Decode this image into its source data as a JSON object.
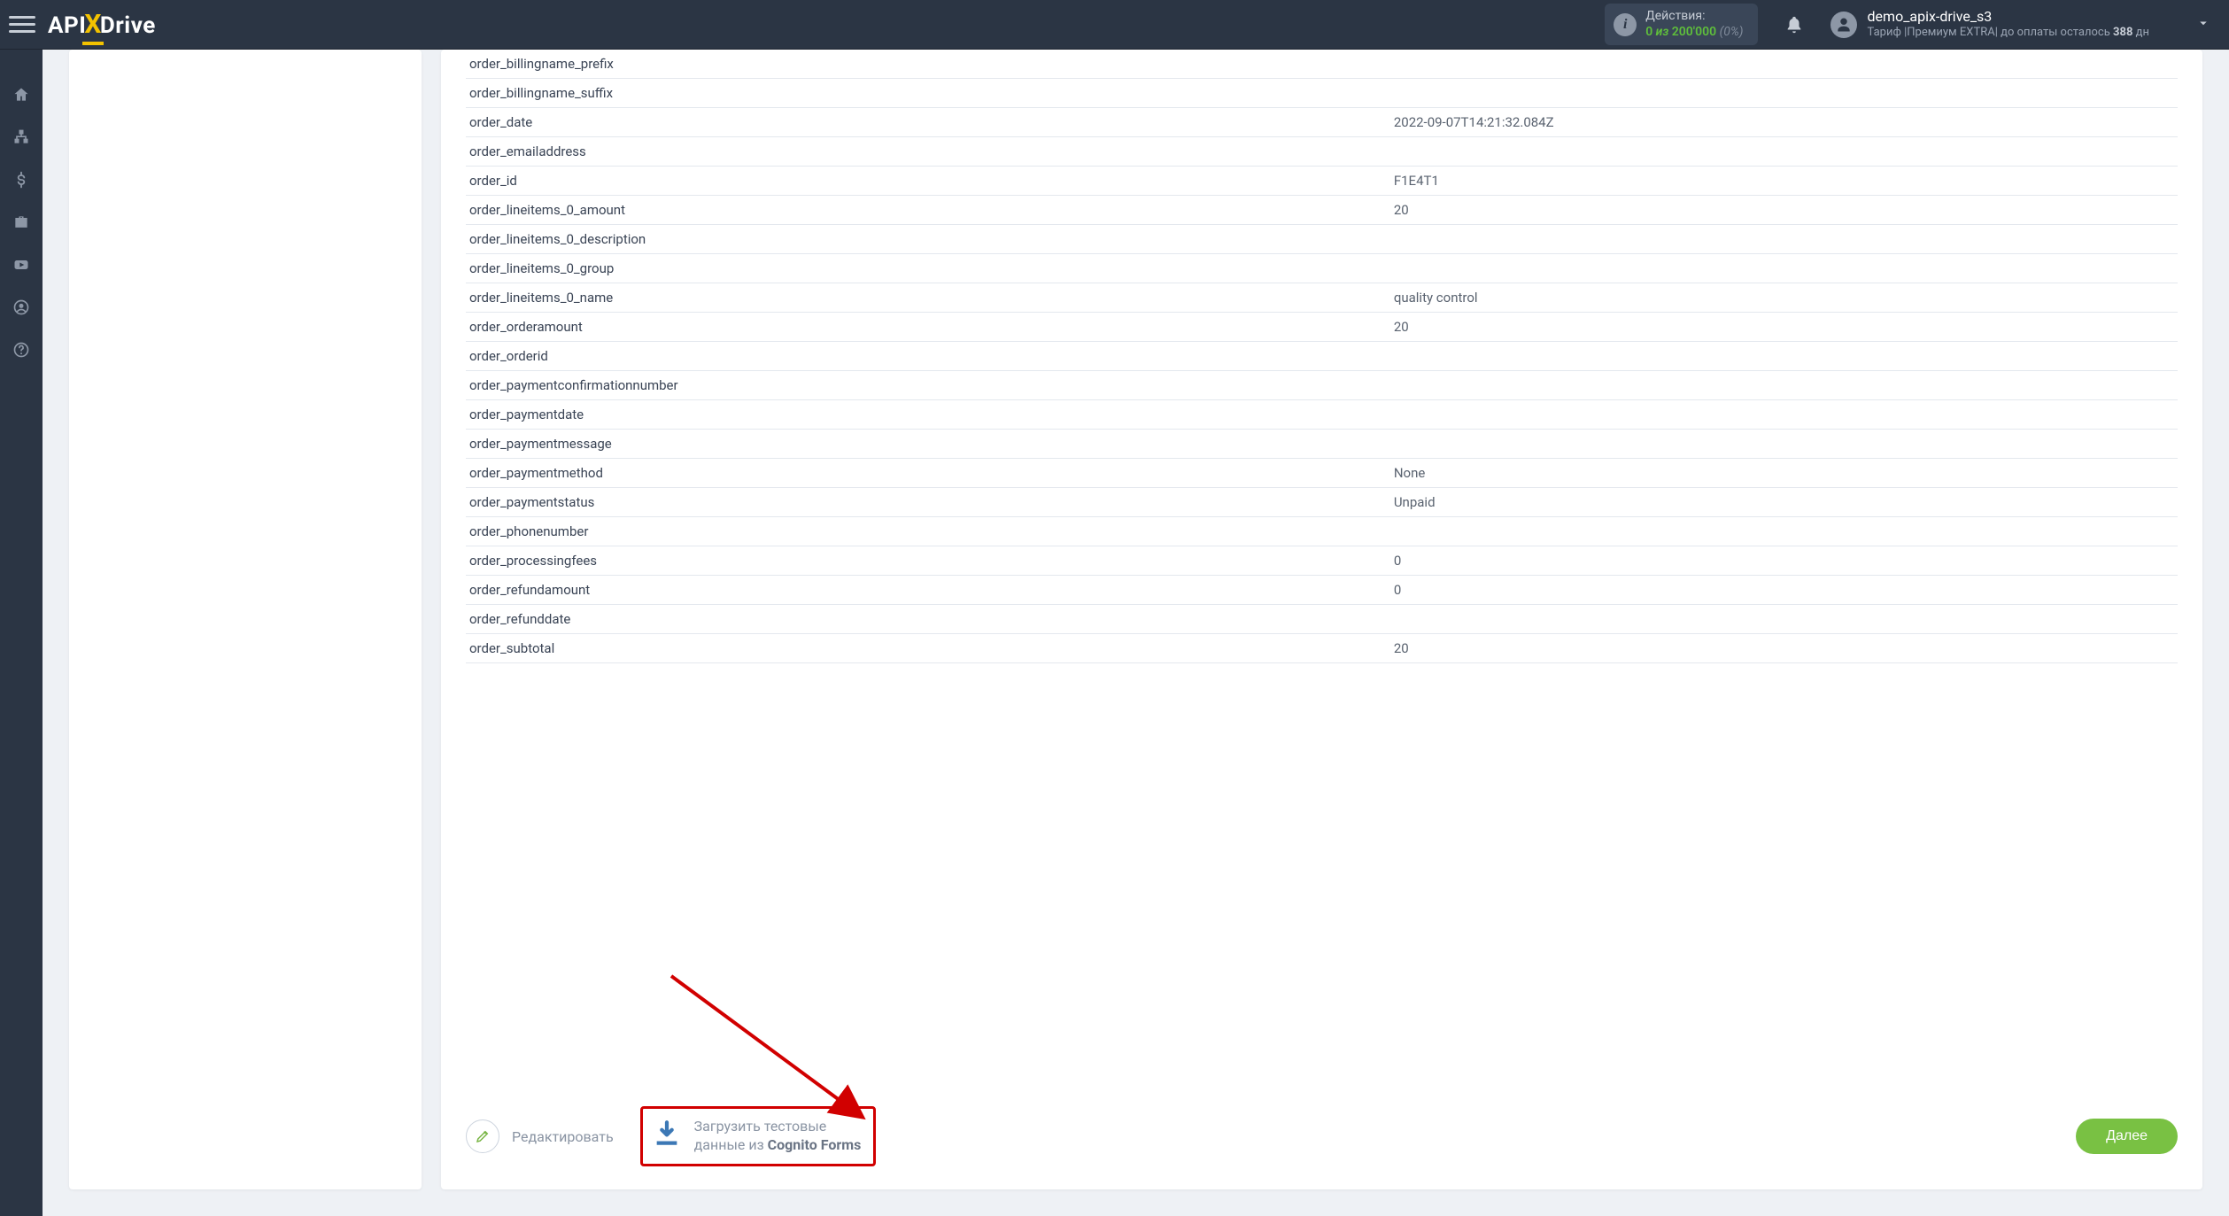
{
  "header": {
    "logo": {
      "part1": "API",
      "partX": "X",
      "part2": "Drive"
    },
    "actions": {
      "label": "Действия:",
      "used": "0",
      "sep": " из ",
      "total": "200'000",
      "pct": "(0%)"
    },
    "user": {
      "name": "demo_apix-drive_s3",
      "plan_prefix": "Тариф |",
      "plan_name": "Премиум EXTRA",
      "plan_mid": "| до оплаты осталось ",
      "days": "388",
      "days_unit": " дн"
    }
  },
  "rows": [
    {
      "key": "order_billingname_prefix",
      "val": ""
    },
    {
      "key": "order_billingname_suffix",
      "val": ""
    },
    {
      "key": "order_date",
      "val": "2022-09-07T14:21:32.084Z"
    },
    {
      "key": "order_emailaddress",
      "val": ""
    },
    {
      "key": "order_id",
      "val": "F1E4T1"
    },
    {
      "key": "order_lineitems_0_amount",
      "val": "20"
    },
    {
      "key": "order_lineitems_0_description",
      "val": ""
    },
    {
      "key": "order_lineitems_0_group",
      "val": ""
    },
    {
      "key": "order_lineitems_0_name",
      "val": "quality control"
    },
    {
      "key": "order_orderamount",
      "val": "20"
    },
    {
      "key": "order_orderid",
      "val": ""
    },
    {
      "key": "order_paymentconfirmationnumber",
      "val": ""
    },
    {
      "key": "order_paymentdate",
      "val": ""
    },
    {
      "key": "order_paymentmessage",
      "val": ""
    },
    {
      "key": "order_paymentmethod",
      "val": "None"
    },
    {
      "key": "order_paymentstatus",
      "val": "Unpaid"
    },
    {
      "key": "order_phonenumber",
      "val": ""
    },
    {
      "key": "order_processingfees",
      "val": "0"
    },
    {
      "key": "order_refundamount",
      "val": "0"
    },
    {
      "key": "order_refunddate",
      "val": ""
    },
    {
      "key": "order_subtotal",
      "val": "20"
    }
  ],
  "buttons": {
    "edit": "Редактировать",
    "load_line1": "Загрузить тестовые",
    "load_line2_pre": "данные из ",
    "load_line2_bold": "Cognito Forms",
    "next": "Далее"
  }
}
